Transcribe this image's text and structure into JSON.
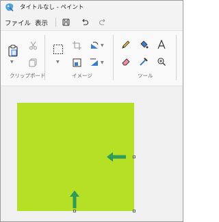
{
  "window": {
    "title": "タイトルなし - ペイント"
  },
  "menubar": {
    "file_label": "ファイル",
    "view_label": "表示"
  },
  "ribbon": {
    "groups": [
      {
        "label": "クリップボード"
      },
      {
        "label": "イメージ"
      },
      {
        "label": "ツール"
      }
    ]
  },
  "canvas": {
    "fill_color": "#b6e026",
    "annotation_arrow_color": "#2f9a5a"
  }
}
